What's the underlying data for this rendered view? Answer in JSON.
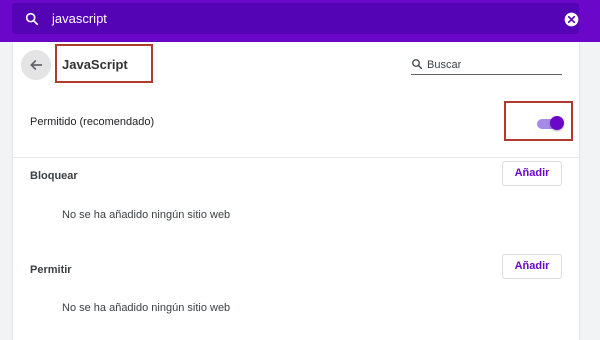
{
  "search": {
    "value": "javascript"
  },
  "page": {
    "title": "JavaScript",
    "search_placeholder": "Buscar"
  },
  "allowed": {
    "label": "Permitido (recomendado)",
    "enabled": true
  },
  "block": {
    "label": "Bloquear",
    "add_label": "Añadir",
    "empty_text": "No se ha añadido ningún sitio web"
  },
  "allow": {
    "label": "Permitir",
    "add_label": "Añadir",
    "empty_text": "No se ha añadido ningún sitio web"
  },
  "colors": {
    "topbar": "#6a07c9",
    "accent": "#6a07c9",
    "highlight_box": "#b03a2e"
  },
  "icons": [
    "search-icon",
    "clear-icon",
    "back-arrow-icon",
    "search-icon"
  ]
}
